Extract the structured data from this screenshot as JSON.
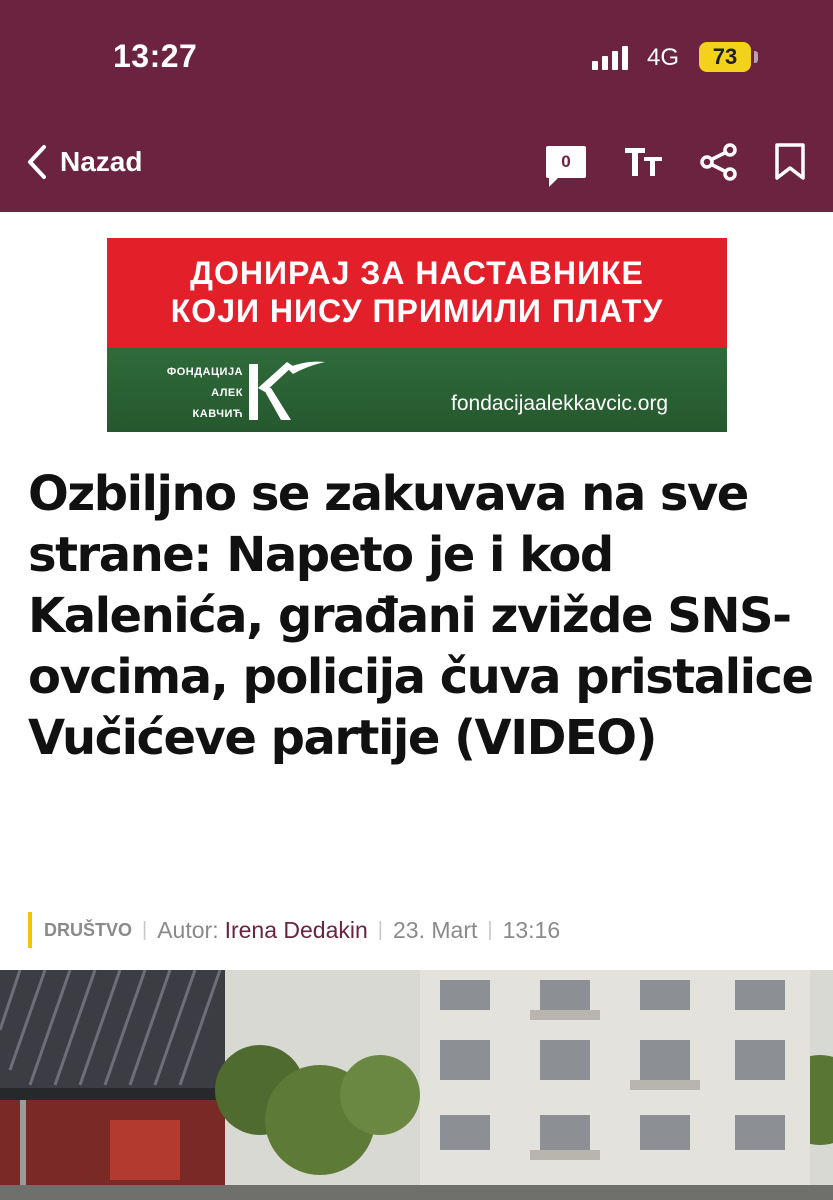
{
  "status_bar": {
    "time": "13:27",
    "network": "4G",
    "battery": "73"
  },
  "toolbar": {
    "back_label": "Nazad",
    "comments_count": "0",
    "text_size_icon": "text-size-icon",
    "share_icon": "share-icon",
    "bookmark_icon": "bookmark-icon"
  },
  "ad_banner": {
    "line1": "ДОНИРАЈ ЗА НАСТАВНИКЕ",
    "line2": "КОЈИ НИСУ ПРИМИЛИ ПЛАТУ",
    "org_line1": "ФОНДАЦИЈА",
    "org_line2": "АЛЕК",
    "org_line3": "КАВЧИЋ",
    "url": "fondacijaalekkavcic.org"
  },
  "article": {
    "headline": "Ozbiljno se zakuvava na sve strane: Napeto je i kod Kalenića, građani zvižde SNS-ovcima, policija čuva pristalice Vučićeve partije (VIDEO)",
    "category": "DRUŠTVO",
    "author_label": "Autor:",
    "author_name": "Irena Dedakin",
    "date": "23. Mart",
    "time": "13:16"
  },
  "colors": {
    "header_bg": "#6b2340",
    "banner_red": "#e3202a",
    "banner_green": "#2f6b3a",
    "category_accent": "#f2c500",
    "author_color": "#6b2340"
  }
}
